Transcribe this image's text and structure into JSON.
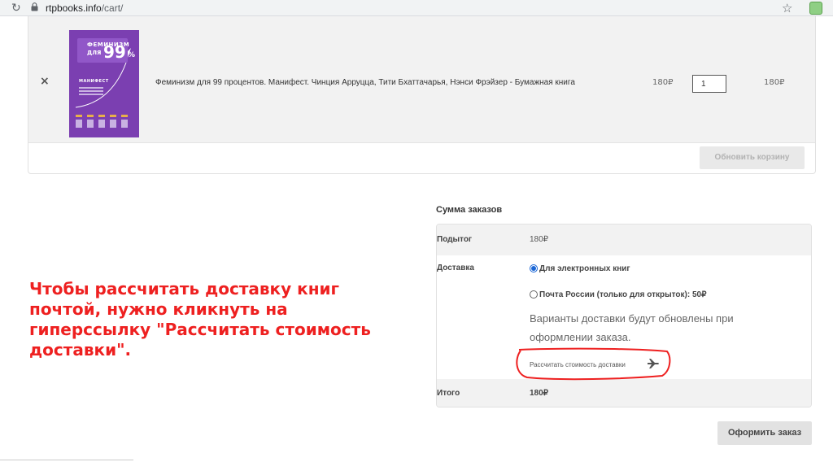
{
  "browser": {
    "url_domain": "rtpbooks.info",
    "url_path": "/cart/",
    "reload_icon": "reload-icon",
    "lock_icon": "lock-icon",
    "star_icon": "star-icon"
  },
  "cart": {
    "item": {
      "remove_symbol": "×",
      "cover": {
        "title_line1": "ФЕМИНИЗМ",
        "title_line2": "ДЛЯ",
        "number": "99",
        "percent": "%",
        "subtitle": "МАНИФЕСТ",
        "color": "#7b3fb1"
      },
      "name": "Феминизм для 99 процентов. Манифест. Чинция Арруцца, Тити Бхаттачарья, Нэнси Фрэйзер - Бумажная книга",
      "price": "180₽",
      "quantity": "1",
      "subtotal": "180₽"
    },
    "update_button": "Обновить корзину"
  },
  "totals": {
    "title": "Сумма заказов",
    "subtotal_label": "Подытог",
    "subtotal_value": "180₽",
    "shipping_label": "Доставка",
    "shipping_options": [
      {
        "label": "Для электронных книг",
        "checked": true
      },
      {
        "label": "Почта России (только для открыток): 50₽",
        "checked": false
      }
    ],
    "shipping_note": "Варианты доставки будут обновлены при оформлении заказа.",
    "calc_link": "Рассчитать стоимость доставки",
    "calc_icon": "plane-icon",
    "total_label": "Итого",
    "total_value": "180₽",
    "checkout_button": "Оформить заказ"
  },
  "annotation": {
    "text": "Чтобы рассчитать доставку книг почтой, нужно кликнуть на гиперссылку \"Рассчитать стоимость доставки\".",
    "color": "#ee2020"
  }
}
